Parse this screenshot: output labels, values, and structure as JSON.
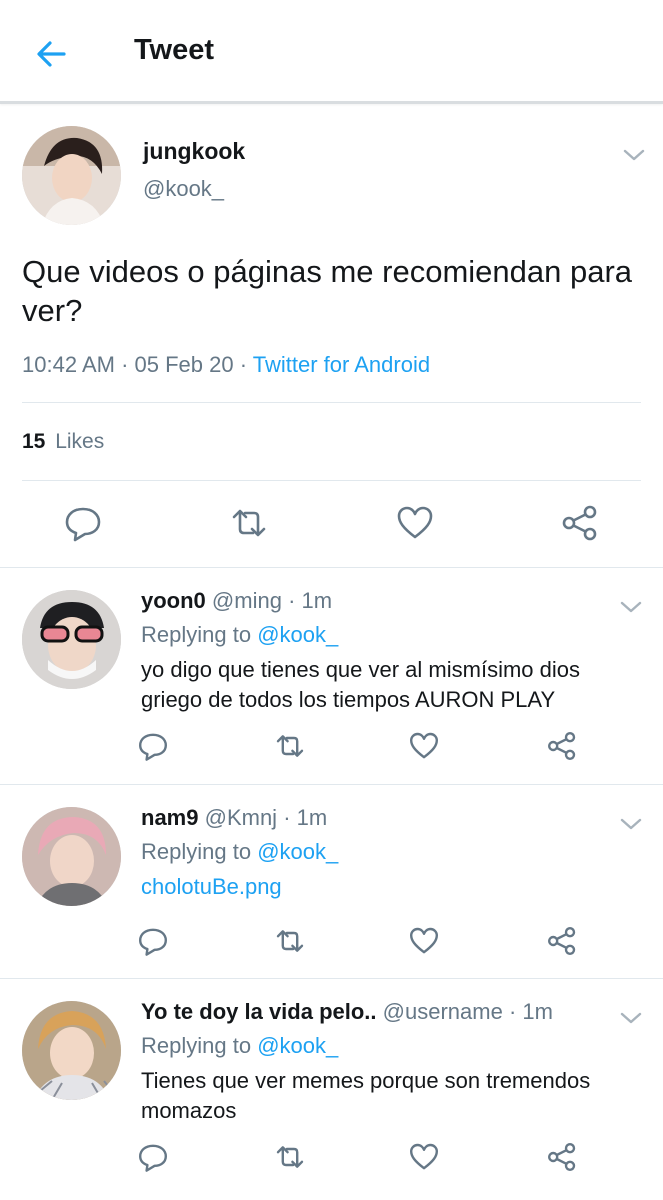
{
  "header": {
    "title": "Tweet",
    "back_icon": "arrow-left-icon",
    "accent": "#1da1f2"
  },
  "main_tweet": {
    "display_name": "jungkook",
    "handle": "@kook_",
    "text": "Que videos o páginas me recomiendan para ver?",
    "time": "10:42 AM",
    "date": "05 Feb 20",
    "source": "Twitter for Android",
    "likes_count": "15",
    "likes_label": "Likes",
    "actions": [
      "reply-icon",
      "retweet-icon",
      "like-icon",
      "share-icon"
    ]
  },
  "replies": [
    {
      "display_name": "yoon0",
      "handle": "@ming",
      "time": "1m",
      "replying_label": "Replying to",
      "replying_to": "@kook_",
      "text": "yo digo que tienes que ver al mismísimo dios griego de todos los tiempos AURON PLAY"
    },
    {
      "display_name": "nam9",
      "handle": "@Kmnj",
      "time": "1m",
      "replying_label": "Replying to",
      "replying_to": "@kook_",
      "text": "cholotuBe.png"
    },
    {
      "display_name": "Yo te doy la vida pelo..",
      "handle": "@username",
      "time": "1m",
      "replying_label": "Replying to",
      "replying_to": "@kook_",
      "text": "Tienes que ver memes porque son tremendos momazos"
    }
  ],
  "colors": {
    "text_primary": "#14171a",
    "text_secondary": "#657786",
    "link": "#1da1f2",
    "divider": "#e1e8ed"
  }
}
